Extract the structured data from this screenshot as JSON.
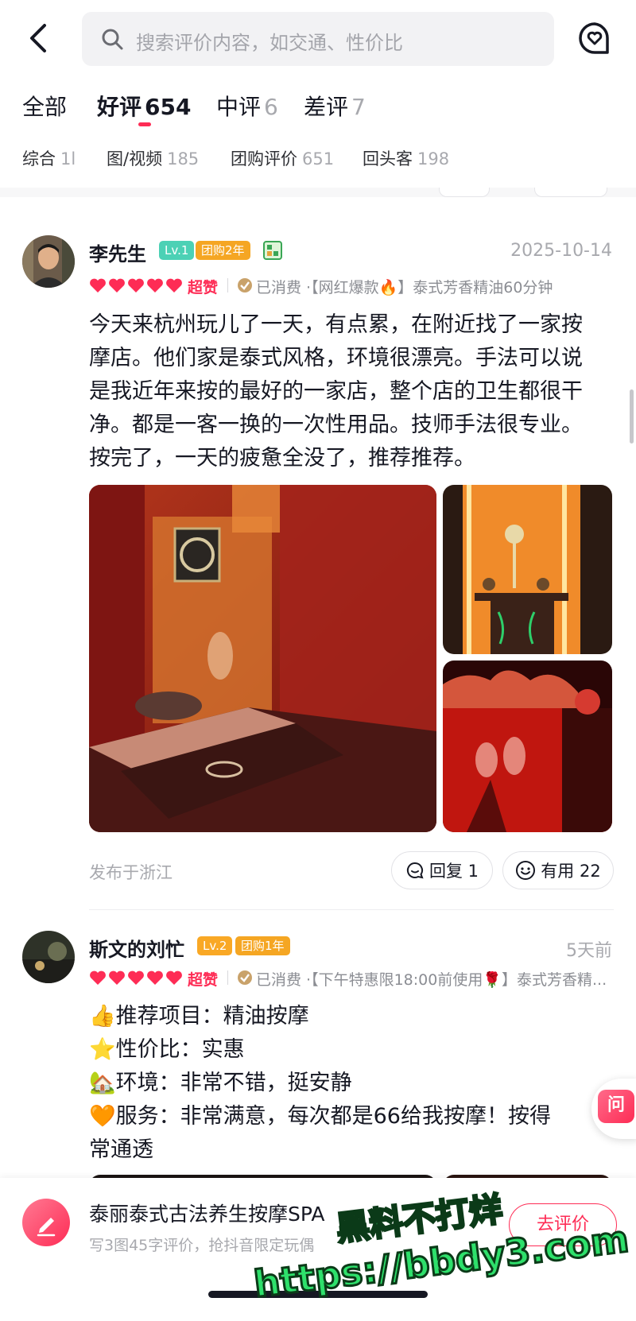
{
  "header": {
    "search_placeholder": "搜索评价内容，如交通、性价比"
  },
  "tabs": [
    {
      "label": "全部",
      "count": ""
    },
    {
      "label": "好评",
      "count": "654"
    },
    {
      "label": "中评",
      "count": "6"
    },
    {
      "label": "差评",
      "count": "7"
    }
  ],
  "filters": [
    {
      "label": "综合",
      "count": "1l"
    },
    {
      "label": "图/视频",
      "count": "185"
    },
    {
      "label": "团购评价",
      "count": "651"
    },
    {
      "label": "回头客",
      "count": "198"
    }
  ],
  "reviews": [
    {
      "user": "李先生",
      "level": "Lv.1",
      "group_badge": "团购2年",
      "date": "2025-10-14",
      "rating": 5,
      "praise": "超赞",
      "meta": "已消费 ·【网红爆款🔥】泰式芳香精油60分钟",
      "lines": [
        "今天来杭州玩儿了一天，有点累，在附近找了一家按",
        "摩店。他们家是泰式风格，环境很漂亮。手法可以说",
        "是我近年来按的最好的一家店，整个店的卫生都很干",
        "净。都是一客一换的一次性用品。技师手法很专业。",
        "按完了，一天的疲惫全没了，推荐推荐。"
      ],
      "location": "发布于浙江",
      "reply_label": "回复 1",
      "useful_label": "有用 22"
    },
    {
      "user": "斯文的刘忙",
      "level": "Lv.2",
      "group_badge": "团购1年",
      "date": "5天前",
      "rating": 5,
      "praise": "超赞",
      "meta": "已消费 ·【下午特惠限18:00前使用🌹】泰式芳香精...",
      "lines": [
        "👍推荐项目：精油按摩",
        "⭐性价比：实惠",
        "🏡环境：非常不错，挺安静",
        "🧡服务：非常满意，每次都是66给我按摩！按得",
        "常通透"
      ]
    }
  ],
  "floating": {
    "ask_label": "问"
  },
  "bottom_bar": {
    "shop_name": "泰丽泰式古法养生按摩SPA",
    "hint": "写3图45字评价，抢抖音限定玩偶",
    "button_label": "去评价"
  },
  "watermark": {
    "line1": "黑料不打烊",
    "line2": "https://bbdy3.com"
  },
  "colors": {
    "accent": "#fe2c55",
    "level1": "#4cd1b5",
    "level2": "#f9a825",
    "group_badge": "#f5a623"
  }
}
